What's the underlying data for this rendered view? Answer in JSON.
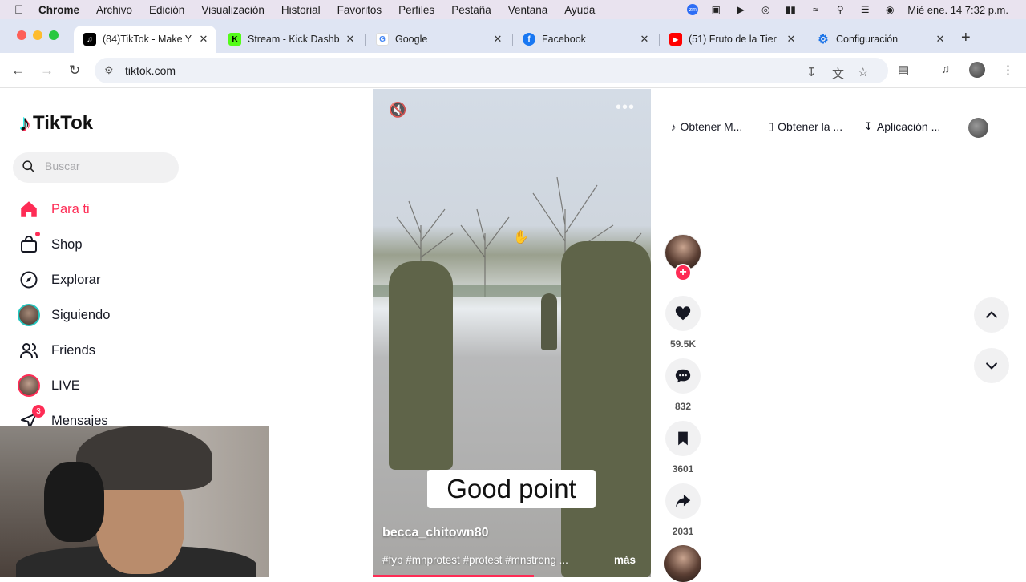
{
  "menubar": {
    "app_name": "Chrome",
    "items": [
      "Archivo",
      "Edición",
      "Visualización",
      "Historial",
      "Favoritos",
      "Perfiles",
      "Pestaña",
      "Ventana",
      "Ayuda"
    ],
    "clock": "Mié ene. 14  7:32 p.m.",
    "zoom_label": "zm"
  },
  "tabs": [
    {
      "title": "(84)TikTok - Make Y",
      "favicon": "tiktok",
      "color": "#000000",
      "active": true
    },
    {
      "title": "Stream - Kick Dashb",
      "favicon": "kick",
      "color": "#53fc18",
      "active": false
    },
    {
      "title": "Google",
      "favicon": "google",
      "color": "#4285f4",
      "active": false
    },
    {
      "title": "Facebook",
      "favicon": "facebook",
      "color": "#1877f2",
      "active": false
    },
    {
      "title": "(51) Fruto de la Tier",
      "favicon": "youtube",
      "color": "#ff0000",
      "active": false
    },
    {
      "title": "Configuración",
      "favicon": "settings",
      "color": "#1a73e8",
      "active": false
    }
  ],
  "address_bar": {
    "url": "tiktok.com"
  },
  "sidebar": {
    "search_placeholder": "Buscar",
    "items": [
      {
        "label": "Para ti",
        "icon": "home-icon"
      },
      {
        "label": "Shop",
        "icon": "shop-icon"
      },
      {
        "label": "Explorar",
        "icon": "compass-icon"
      },
      {
        "label": "Siguiendo",
        "icon": "following-avatar"
      },
      {
        "label": "Friends",
        "icon": "friends-icon"
      },
      {
        "label": "LIVE",
        "icon": "live-avatar"
      },
      {
        "label": "Mensajes",
        "icon": "messages-icon",
        "badge": "3"
      }
    ]
  },
  "header_links": [
    {
      "label": "Obtener M...",
      "icon": "coin-icon"
    },
    {
      "label": "Obtener la ...",
      "icon": "phone-icon"
    },
    {
      "label": "Aplicación ...",
      "icon": "download-icon"
    }
  ],
  "video": {
    "caption_text": "Good point",
    "author": "becca_chitown80",
    "tags": "#fyp #mnprotest #protest #mnstrong ...",
    "more_label": "más",
    "progress": 0.58
  },
  "actions": {
    "likes": "59.5K",
    "comments": "832",
    "saves": "3601",
    "shares": "2031"
  },
  "colors": {
    "accent": "#fe2c55",
    "tab_strip": "#dfe5f3"
  }
}
